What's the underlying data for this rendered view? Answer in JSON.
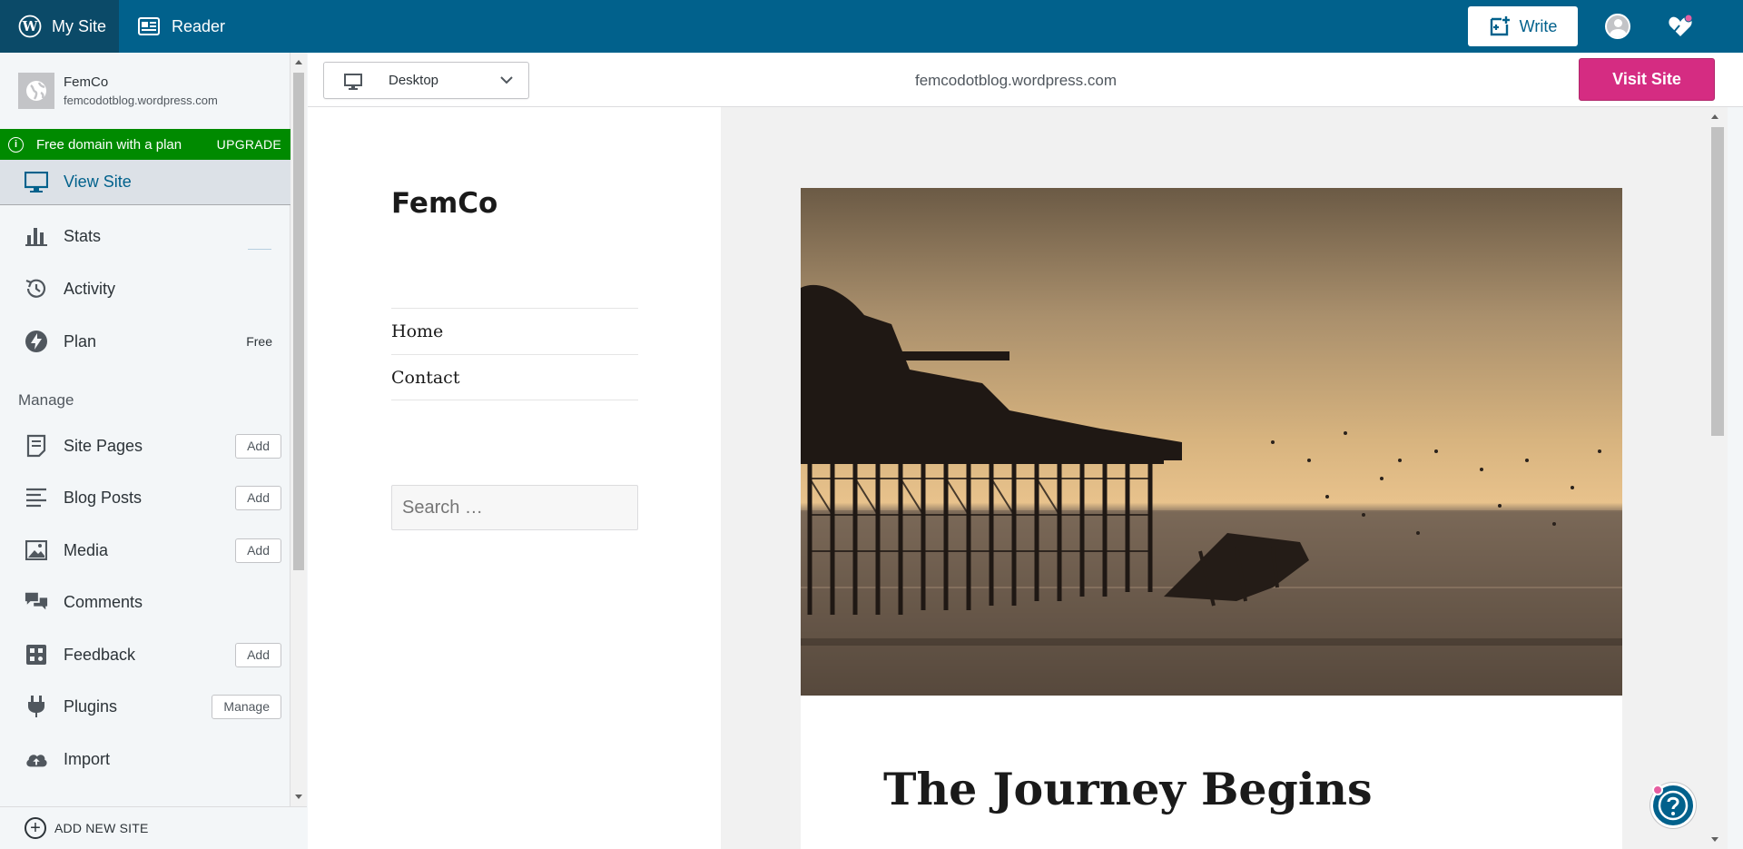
{
  "masterbar": {
    "my_site": "My Site",
    "reader": "Reader",
    "write": "Write"
  },
  "site": {
    "name": "FemCo",
    "url": "femcodotblog.wordpress.com"
  },
  "domain_banner": {
    "text": "Free domain with a plan",
    "action": "UPGRADE"
  },
  "sidebar": {
    "view_site": "View Site",
    "stats": "Stats",
    "activity": "Activity",
    "plan": "Plan",
    "plan_badge": "Free",
    "manage_heading": "Manage",
    "site_pages": "Site Pages",
    "blog_posts": "Blog Posts",
    "media": "Media",
    "comments": "Comments",
    "feedback": "Feedback",
    "plugins": "Plugins",
    "import": "Import",
    "add_label": "Add",
    "manage_label": "Manage",
    "add_new_site": "ADD NEW SITE"
  },
  "preview": {
    "device": "Desktop",
    "url": "femcodotblog.wordpress.com",
    "visit_site": "Visit Site",
    "theme": {
      "title": "FemCo",
      "nav": [
        "Home",
        "Contact"
      ],
      "search_placeholder": "Search …",
      "post_title": "The Journey Begins"
    }
  },
  "colors": {
    "masterbar": "#01618c",
    "banner": "#008a00",
    "visit_button": "#d52c82"
  }
}
